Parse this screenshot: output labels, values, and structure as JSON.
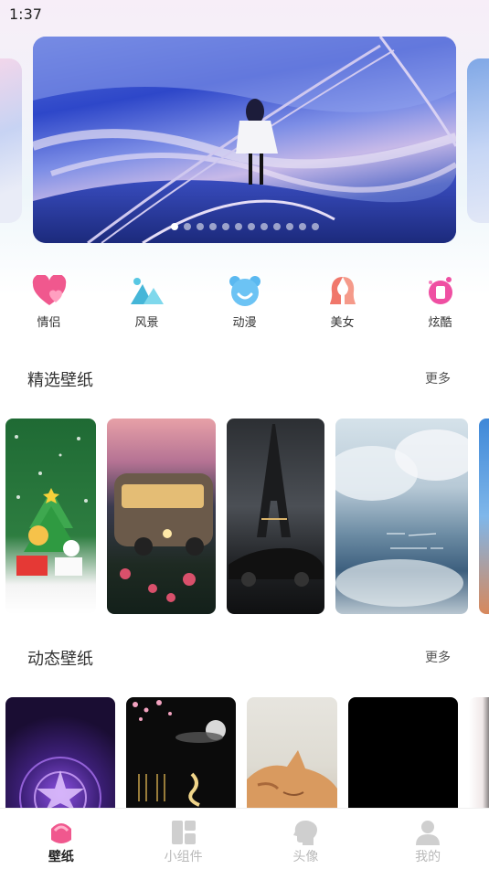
{
  "status": {
    "time": "1:37"
  },
  "banner": {
    "dot_count": 12,
    "active_dot": 0
  },
  "categories": [
    {
      "label": "情侣",
      "icon": "heart-icon",
      "color": "#f0588e"
    },
    {
      "label": "风景",
      "icon": "mountain-icon",
      "color": "#57c7e3"
    },
    {
      "label": "动漫",
      "icon": "bear-icon",
      "color": "#5ab8f0"
    },
    {
      "label": "美女",
      "icon": "woman-icon",
      "color": "#f0776b"
    },
    {
      "label": "炫酷",
      "icon": "splash-icon",
      "color": "#ef4fa2"
    }
  ],
  "featured": {
    "title": "精选壁纸",
    "more": "更多"
  },
  "live": {
    "title": "动态壁纸",
    "more": "更多"
  },
  "nav": [
    {
      "label": "壁纸",
      "icon": "wallpaper-icon",
      "active": true
    },
    {
      "label": "小组件",
      "icon": "widget-icon",
      "active": false
    },
    {
      "label": "头像",
      "icon": "avatar-head-icon",
      "active": false
    },
    {
      "label": "我的",
      "icon": "profile-icon",
      "active": false
    }
  ],
  "colors": {
    "accent": "#f0588e",
    "nav_inactive": "#b9b9b9"
  }
}
